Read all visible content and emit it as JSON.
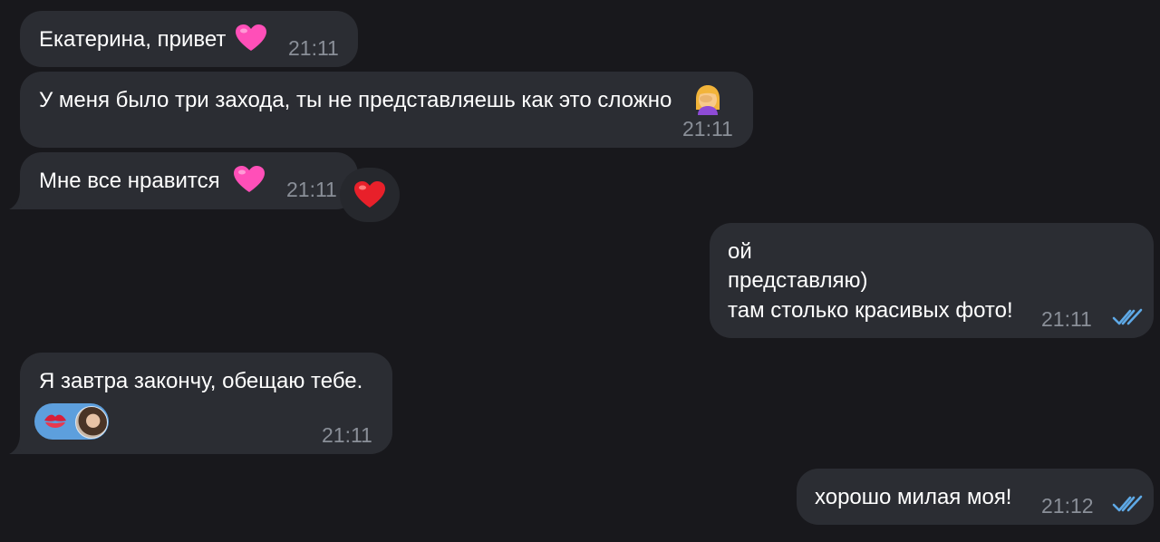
{
  "messages": {
    "m1": {
      "text": "Екатерина, привет",
      "time": "21:11",
      "emoji": "pink-heart"
    },
    "m2": {
      "text": "У меня было три захода, ты не представляешь как это сложно",
      "time": "21:11",
      "emoji": "woman-facepalming"
    },
    "m3": {
      "text": "Мне все нравится",
      "time": "21:11",
      "emoji": "pink-heart",
      "reaction": "red-heart"
    },
    "m4": {
      "lines": [
        "ой",
        "представляю)",
        "там столько красивых фото!"
      ],
      "time": "21:11",
      "status": "read"
    },
    "m5": {
      "text": "Я завтра закончу, обещаю тебе.",
      "time": "21:11",
      "reaction": "kiss-mark"
    },
    "m6": {
      "text": "хорошо милая моя!",
      "time": "21:12",
      "status": "read"
    }
  },
  "colors": {
    "background": "#18181c",
    "bubble": "#2b2d33",
    "time": "#8a8f98",
    "reaction_chip": "#5d9fdd",
    "ticks": "#5ea9e6"
  }
}
